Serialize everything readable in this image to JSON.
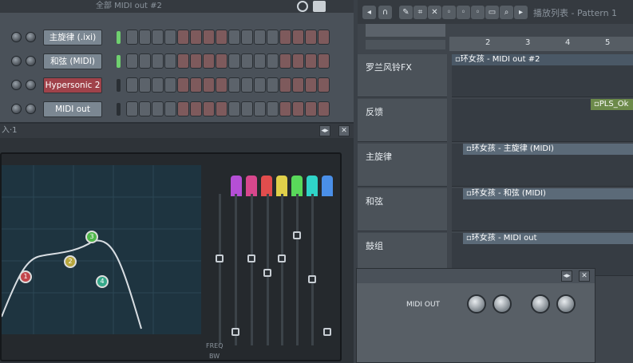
{
  "rack": {
    "title": "全部  MIDI out #2",
    "channels": [
      {
        "name": "主旋律 (.ixi)",
        "led": true,
        "red": false
      },
      {
        "name": "和弦 (MIDI)",
        "led": true,
        "red": false
      },
      {
        "name": "Hypersonic 2",
        "led": false,
        "red": true
      },
      {
        "name": "MIDI out",
        "led": false,
        "red": false
      }
    ]
  },
  "mixer": {
    "title": "入·1",
    "eq_nodes": [
      "1",
      "2",
      "3",
      "4"
    ],
    "band_colors": [
      "#b54fd6",
      "#d8478d",
      "#e24d4d",
      "#e0d04a",
      "#59d85a",
      "#2fd4c8",
      "#4a8fe8"
    ],
    "freq_label": "FREQ",
    "bw_label": "BW"
  },
  "playlist": {
    "title": "播放列表 - Pattern 1",
    "ruler": [
      "2",
      "3",
      "4",
      "5"
    ],
    "tracks": [
      {
        "name": "罗兰风铃FX",
        "clip": "▫环女孩 - MIDI out #2"
      },
      {
        "name": "反馈",
        "clip": "▫PLS_Ok"
      },
      {
        "name": "主旋律",
        "clip": "▫环女孩 - 主旋律 (MIDI)"
      },
      {
        "name": "和弦",
        "clip": "▫环女孩 - 和弦 (MIDI)"
      },
      {
        "name": "鼓组",
        "clip": "▫环女孩 - MIDI out"
      }
    ]
  },
  "plugin": {
    "name": "MIDI OUT"
  },
  "colors": {
    "accent_red": "#a0424a",
    "panel": "#4a5159"
  }
}
